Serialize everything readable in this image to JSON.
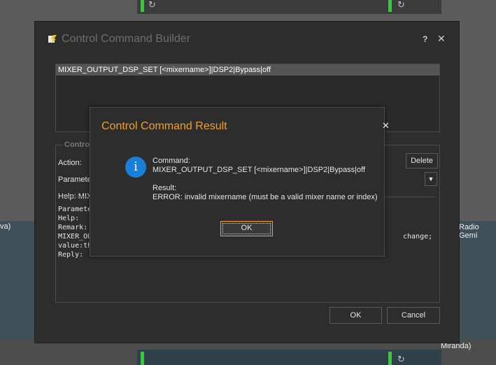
{
  "background": {
    "labels": {
      "left_partial": "va)",
      "right_partial": "Radio Gemi",
      "bottom_right_partial": "Miranda)"
    },
    "refresh_icon": "refresh-icon"
  },
  "builder": {
    "title": "Control Command Builder",
    "help_label": "?",
    "close_label": "✕",
    "command_item": "MIXER_OUTPUT_DSP_SET [<mixername>]|DSP2|Bypass|off",
    "group_legend": "Contro",
    "action_label": "Action:",
    "parameter_label": "Paramete",
    "help_line": "Help: MIX",
    "delete_label": "Delete",
    "mono_lines": [
      "Paramete",
      "Help:",
      "Remark:",
      "MIXER_OU",
      "value:th",
      "Reply:"
    ],
    "mono_right": "change;",
    "ok_label": "OK",
    "cancel_label": "Cancel"
  },
  "result": {
    "title": "Control Command Result",
    "close_label": "✕",
    "command_label": "Command:",
    "command_value": "MIXER_OUTPUT_DSP_SET [<mixername>]|DSP2|Bypass|off",
    "result_label": "Result:",
    "result_value": "ERROR: invalid mixername (must be a valid mixer name or index)",
    "ok_label": "OK",
    "info_icon_glyph": "i"
  },
  "colors": {
    "accent": "#f0a030",
    "info": "#1a7fd8",
    "status_green": "#2fd02f"
  }
}
